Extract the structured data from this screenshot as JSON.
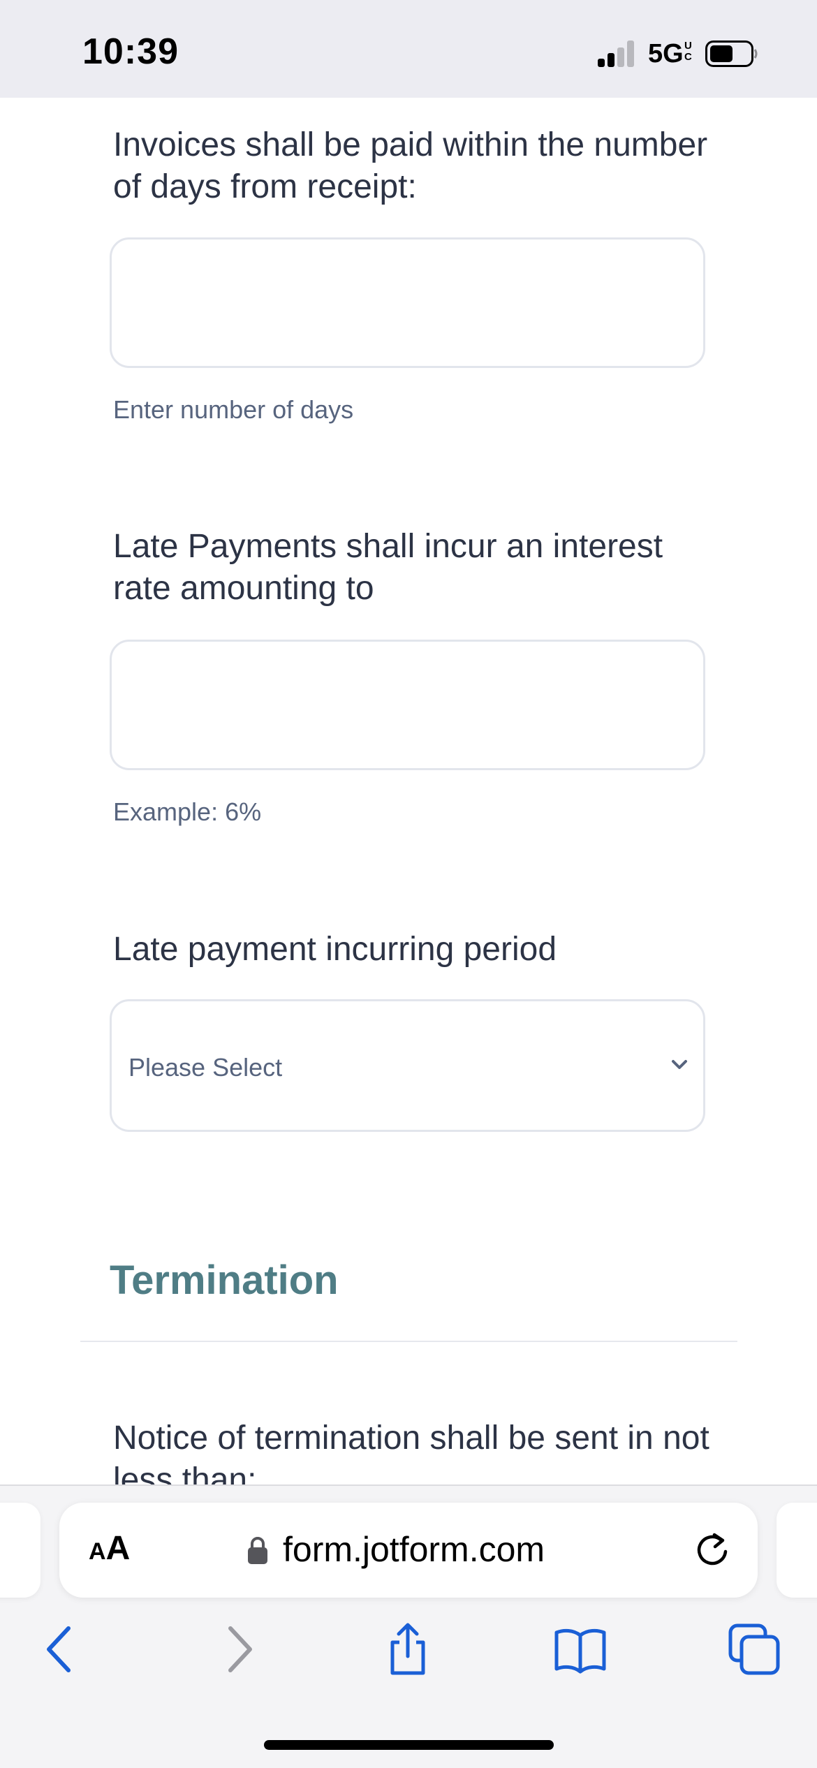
{
  "status_bar": {
    "time": "10:39",
    "network": "5G",
    "network_suffix": "UC"
  },
  "form": {
    "q_invoice_days": {
      "label": "Invoices shall be paid within the number of days from receipt:",
      "value": "",
      "sublabel": "Enter number of days"
    },
    "q_late_interest": {
      "label": "Late Payments shall incur an interest rate amounting to",
      "value": "",
      "sublabel": "Example: 6%"
    },
    "q_late_period": {
      "label": "Late payment incurring period",
      "selected": "Please Select"
    },
    "section_termination": {
      "heading": "Termination"
    },
    "q_termination_notice": {
      "label": "Notice of termination shall be sent in not less than:"
    },
    "colors": {
      "label_text": "#2c3345",
      "sublabel_text": "#57647e",
      "field_border": "#e2e5ec",
      "section_heading": "#4f7d85"
    }
  },
  "browser": {
    "text_size_button": {
      "small": "A",
      "large": "A"
    },
    "url": "form.jotform.com",
    "accent": "#1a5fd6",
    "icons": [
      "back-icon",
      "forward-icon",
      "share-icon",
      "bookmarks-icon",
      "tabs-icon",
      "reload-icon",
      "lock-icon"
    ]
  }
}
